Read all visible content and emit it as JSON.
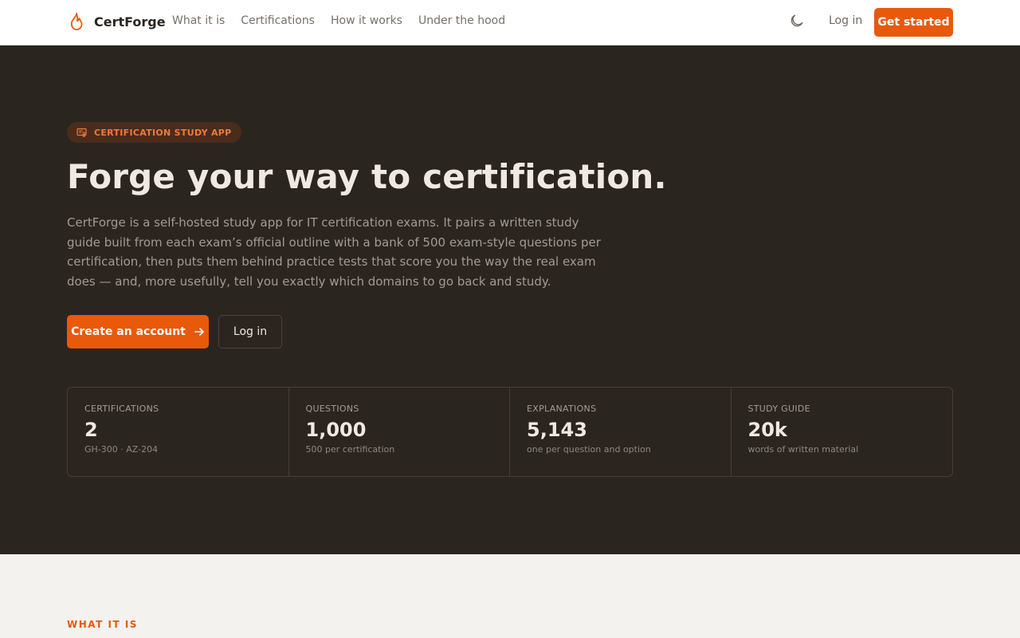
{
  "header": {
    "brand_name": "CertForge",
    "nav": [
      "What it is",
      "Certifications",
      "How it works",
      "Under the hood"
    ],
    "login_label": "Log in",
    "cta_label": "Get started",
    "theme_icon": "moon-icon"
  },
  "hero": {
    "badge_label": "CERTIFICATION STUDY APP",
    "title": "Forge your way to certification.",
    "description": "CertForge is a self-hosted study app for IT certification exams. It pairs a written study guide built from each exam’s official outline with a bank of 500 exam-style questions per certification, then puts them behind practice tests that score you the way the real exam does — and, more usefully, tell you exactly which domains to go back and study.",
    "primary_button": "Create an account",
    "secondary_button": "Log in"
  },
  "stats": [
    {
      "label": "CERTIFICATIONS",
      "value": "2",
      "sub": "GH-300 · AZ-204"
    },
    {
      "label": "QUESTIONS",
      "value": "1,000",
      "sub": "500 per certification"
    },
    {
      "label": "EXPLANATIONS",
      "value": "5,143",
      "sub": "one per question and option"
    },
    {
      "label": "STUDY GUIDE",
      "value": "20k",
      "sub": "words of written material"
    }
  ],
  "section": {
    "label": "WHAT IT IS"
  },
  "colors": {
    "accent": "#e8590c",
    "hero_bg": "#2b2520",
    "page_bg": "#f4f2ef"
  }
}
